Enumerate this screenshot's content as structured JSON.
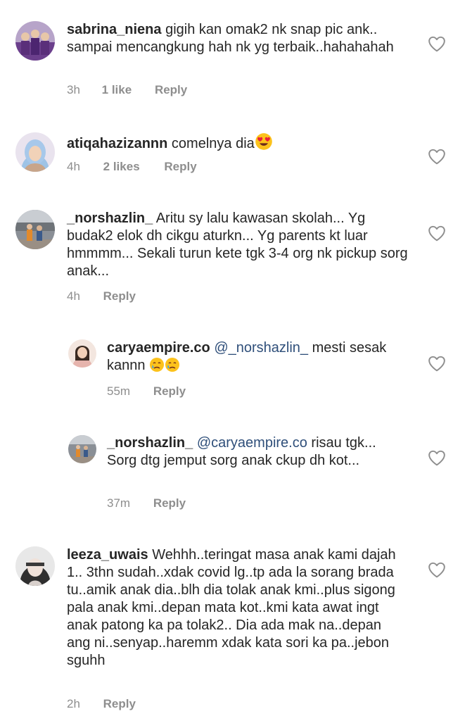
{
  "comments": [
    {
      "username": "sabrina_niena",
      "text_1": "gigih kan omak2 nk snap pic ank.. sampai mencangkung hah nk yg terbaik..hahahahah",
      "time": "3h",
      "likes": "1 like",
      "reply": "Reply"
    },
    {
      "username": "atiqahazizannn",
      "text_1": "comelnya dia",
      "emoji": "heart-eyes-emoji",
      "time": "4h",
      "likes": "2 likes",
      "reply": "Reply"
    },
    {
      "username": "_norshazlin_",
      "text_1": "Aritu sy lalu kawasan skolah... Yg budak2 elok dh cikgu aturkn... Yg parents kt luar hmmmm... Sekali turun kete tgk 3-4 org nk pickup sorg anak...",
      "time": "4h",
      "reply": "Reply"
    },
    {
      "username": "caryaempire.co",
      "mention": "@_norshazlin_",
      "text_1": "mesti sesak kannn",
      "emoji": "crying-face-emoji",
      "time": "55m",
      "reply": "Reply"
    },
    {
      "username": "_norshazlin_",
      "mention": "@caryaempire.co",
      "text_1": "risau tgk... Sorg dtg jemput sorg anak ckup dh kot...",
      "time": "37m",
      "reply": "Reply"
    },
    {
      "username": "leeza_uwais",
      "text_1": "Wehhh..teringat masa anak kami dajah 1.. 3thn sudah..xdak covid lg..tp ada la sorang brada tu..amik anak dia..blh dia tolak anak kmi..plus sigong pala anak kmi..depan mata kot..kmi kata awat ingt anak patong ka pa tolak2.. Dia ada mak na..depan ang ni..senyap..haremm xdak kata sori ka pa..jebon sguhh",
      "time": "2h",
      "reply": "Reply"
    }
  ],
  "colors": {
    "text": "#262626",
    "meta": "#8e8e8e",
    "mention": "#2f4f7a"
  }
}
